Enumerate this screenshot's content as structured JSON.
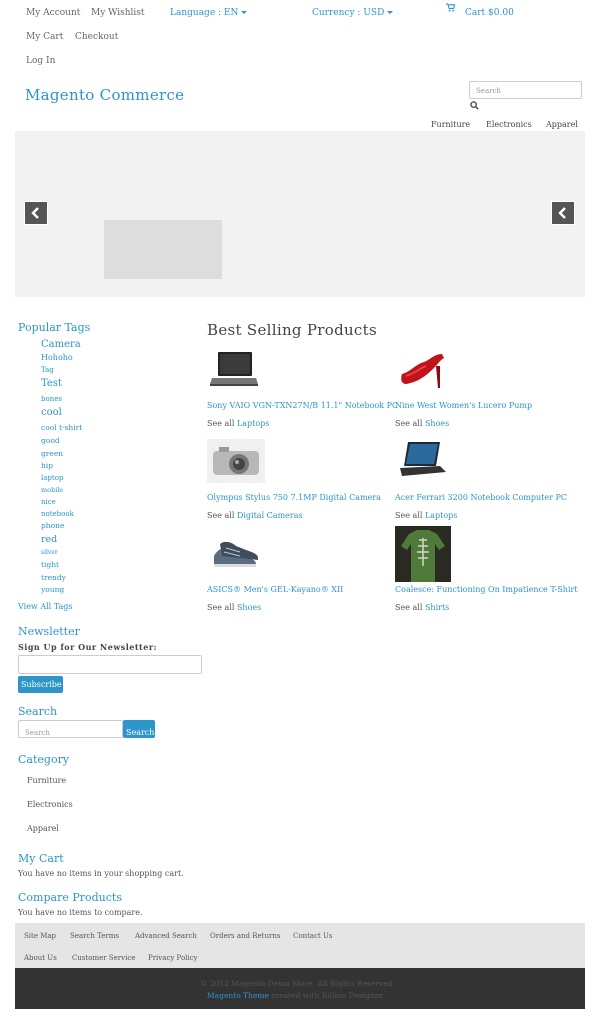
{
  "header": {
    "my_account": "My Account",
    "my_wishlist": "My Wishlist",
    "language_label": "Language",
    "language_value": ": EN",
    "currency_label": "Currency",
    "currency_value": ": USD",
    "cart_label": "Cart",
    "cart_total": "$0.00",
    "my_cart": "My Cart",
    "checkout": "Checkout",
    "log_in": "Log In"
  },
  "logo": "Magento Commerce",
  "search_top": {
    "placeholder": "Search"
  },
  "main_nav": [
    "Furniture",
    "Electronics",
    "Apparel"
  ],
  "sidebar": {
    "popular_tags_title": "Popular Tags",
    "tags": [
      "Camera",
      "Hohoho",
      "Tag",
      "Test",
      "bones",
      "cool",
      "cool  t-shirt",
      "good",
      "green",
      "hip",
      "laptop",
      "mobile",
      "nice",
      "notebook",
      "phone",
      "red",
      "silver",
      "tight",
      "trendy",
      "young"
    ],
    "view_all_tags": "View All Tags",
    "newsletter_title": "Newsletter",
    "newsletter_label": "Sign Up for Our Newsletter:",
    "subscribe": "Subscribe",
    "search_title": "Search",
    "search_placeholder": "Search",
    "search_button": "Search",
    "category_title": "Category",
    "categories": [
      "Furniture",
      "Electronics",
      "Apparel"
    ],
    "my_cart_title": "My Cart",
    "my_cart_text": "You have no items in your shopping cart.",
    "compare_title": "Compare Products",
    "compare_text": "You have no items to compare."
  },
  "best_selling": {
    "title": "Best Selling Products",
    "see_all": "See all",
    "products": [
      {
        "name": "Sony VAIO VGN-TXN27N/B 11.1\" Notebook PC",
        "category": "Laptops",
        "icon": "laptop-icon"
      },
      {
        "name": "Nine West Women's Lucero Pump",
        "category": "Shoes",
        "icon": "red-pump-icon"
      },
      {
        "name": "Olympus Stylus 750 7.1MP Digital Camera",
        "category": "Digital Cameras",
        "icon": "camera-icon"
      },
      {
        "name": "Acer Ferrari 3200 Notebook Computer PC",
        "category": "Laptops",
        "icon": "laptop-icon"
      },
      {
        "name": "ASICS® Men's GEL-Kayano® XII",
        "category": "Shoes",
        "icon": "sneaker-icon"
      },
      {
        "name": "Coalesce: Functioning On Impatience T-Shirt",
        "category": "Shirts",
        "icon": "tshirt-icon"
      }
    ]
  },
  "footer": {
    "links_row1": [
      "Site Map",
      "Search Terms",
      "Advanced Search",
      "Orders and Returns",
      "Contact Us"
    ],
    "links_row2": [
      "About Us",
      "Customer Service",
      "Privacy Policy"
    ],
    "copyright": "© 2012 Magento Demo Store. All Rights Reserved.",
    "theme_link": "Magento Theme",
    "theme_suffix": "created with Billion Designer."
  },
  "colors": {
    "accent": "#2c95c9",
    "footer_bg": "#e5e5e5",
    "footer_dark": "#333333"
  }
}
